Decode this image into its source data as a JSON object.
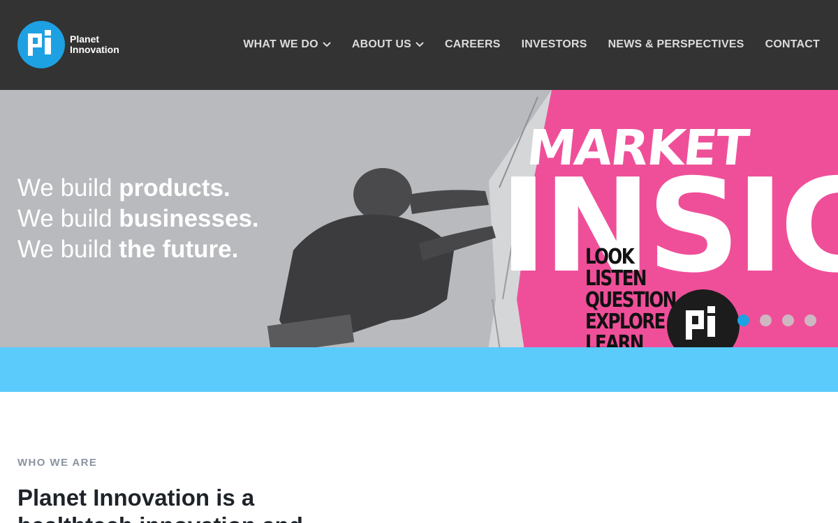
{
  "brand": {
    "name_line1": "Planet",
    "name_line2": "Innovation",
    "mark": "pi",
    "color": "#1ea1e2"
  },
  "nav": {
    "items": [
      {
        "label": "WHAT WE DO",
        "has_dropdown": true
      },
      {
        "label": "ABOUT US",
        "has_dropdown": true
      },
      {
        "label": "CAREERS",
        "has_dropdown": false
      },
      {
        "label": "INVESTORS",
        "has_dropdown": false
      },
      {
        "label": "NEWS & PERSPECTIVES",
        "has_dropdown": false
      },
      {
        "label": "CONTACT",
        "has_dropdown": false
      }
    ]
  },
  "hero": {
    "lines": [
      {
        "prefix": "We build ",
        "emphasis": "products."
      },
      {
        "prefix": "We build ",
        "emphasis": "businesses."
      },
      {
        "prefix": "We build ",
        "emphasis": "the future."
      }
    ],
    "artwork": {
      "title_small": "MARKET",
      "title_large": "INSIGHT",
      "words": [
        "LOOK",
        "LISTEN",
        "QUESTION",
        "EXPLORE",
        "LEARN"
      ],
      "badge_mark": "pi"
    },
    "colors": {
      "pink": "#ef4f99",
      "wall": "#b9babe",
      "band": "#5bcbfb"
    },
    "slides": {
      "count": 4,
      "active": 1
    }
  },
  "about": {
    "eyebrow": "WHO WE ARE",
    "headline": "Planet Innovation is a healthtech innovation and"
  },
  "icons": {
    "chevron": "chevron-down-icon",
    "logo": "pi-logo-icon"
  }
}
